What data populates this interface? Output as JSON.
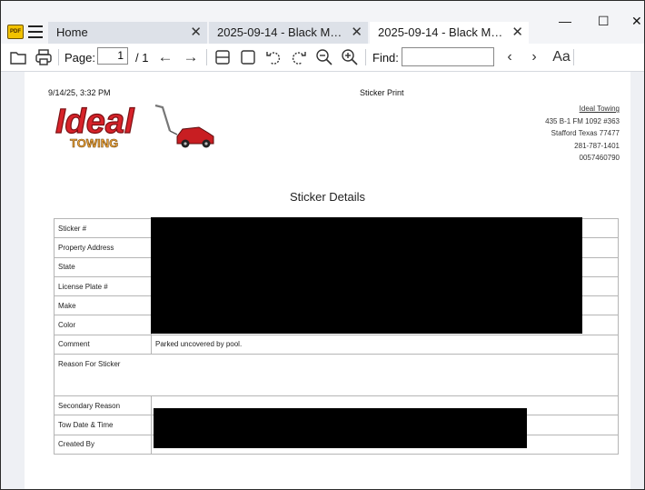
{
  "app": {
    "logo_text": "PDF",
    "tabs": [
      {
        "label": "Home"
      },
      {
        "label": "2025-09-14 - Black Mercedes"
      },
      {
        "label": "2025-09-14 - Black Mercedes"
      }
    ],
    "window_controls": {
      "minimize": "—",
      "maximize": "☐",
      "close": "✕"
    }
  },
  "toolbar": {
    "page_label": "Page:",
    "page_current": "1",
    "page_total": "/ 1",
    "find_label": "Find:",
    "find_value": ""
  },
  "document": {
    "header_datetime": "9/14/25, 3:32 PM",
    "header_title": "Sticker Print",
    "logo_text": "Ideal Towing",
    "company": {
      "name": "Ideal Towing",
      "address1": "435 B-1 FM 1092 #363",
      "address2": "Stafford Texas 77477",
      "phone": "281-787-1401",
      "license": "0057460790"
    },
    "title": "Sticker Details",
    "rows": [
      {
        "label": "Sticker #",
        "value": ""
      },
      {
        "label": "Property Address",
        "value": ""
      },
      {
        "label": "State",
        "value": ""
      },
      {
        "label": "License Plate #",
        "value": ""
      },
      {
        "label": "Make",
        "value": ""
      },
      {
        "label": "Color",
        "value": ""
      },
      {
        "label": "Comment",
        "value": "Parked uncovered by pool."
      },
      {
        "label": "Reason For Sticker",
        "value": ""
      },
      {
        "label": "Secondary Reason",
        "value": ""
      },
      {
        "label": "Tow Date & Time",
        "value": ""
      },
      {
        "label": "Created By",
        "value": ""
      }
    ]
  },
  "colors": {
    "tab_inactive": "#dde1e8",
    "tab_active": "#ffffff",
    "logo_red": "#d8232a",
    "redaction": "#000000"
  }
}
